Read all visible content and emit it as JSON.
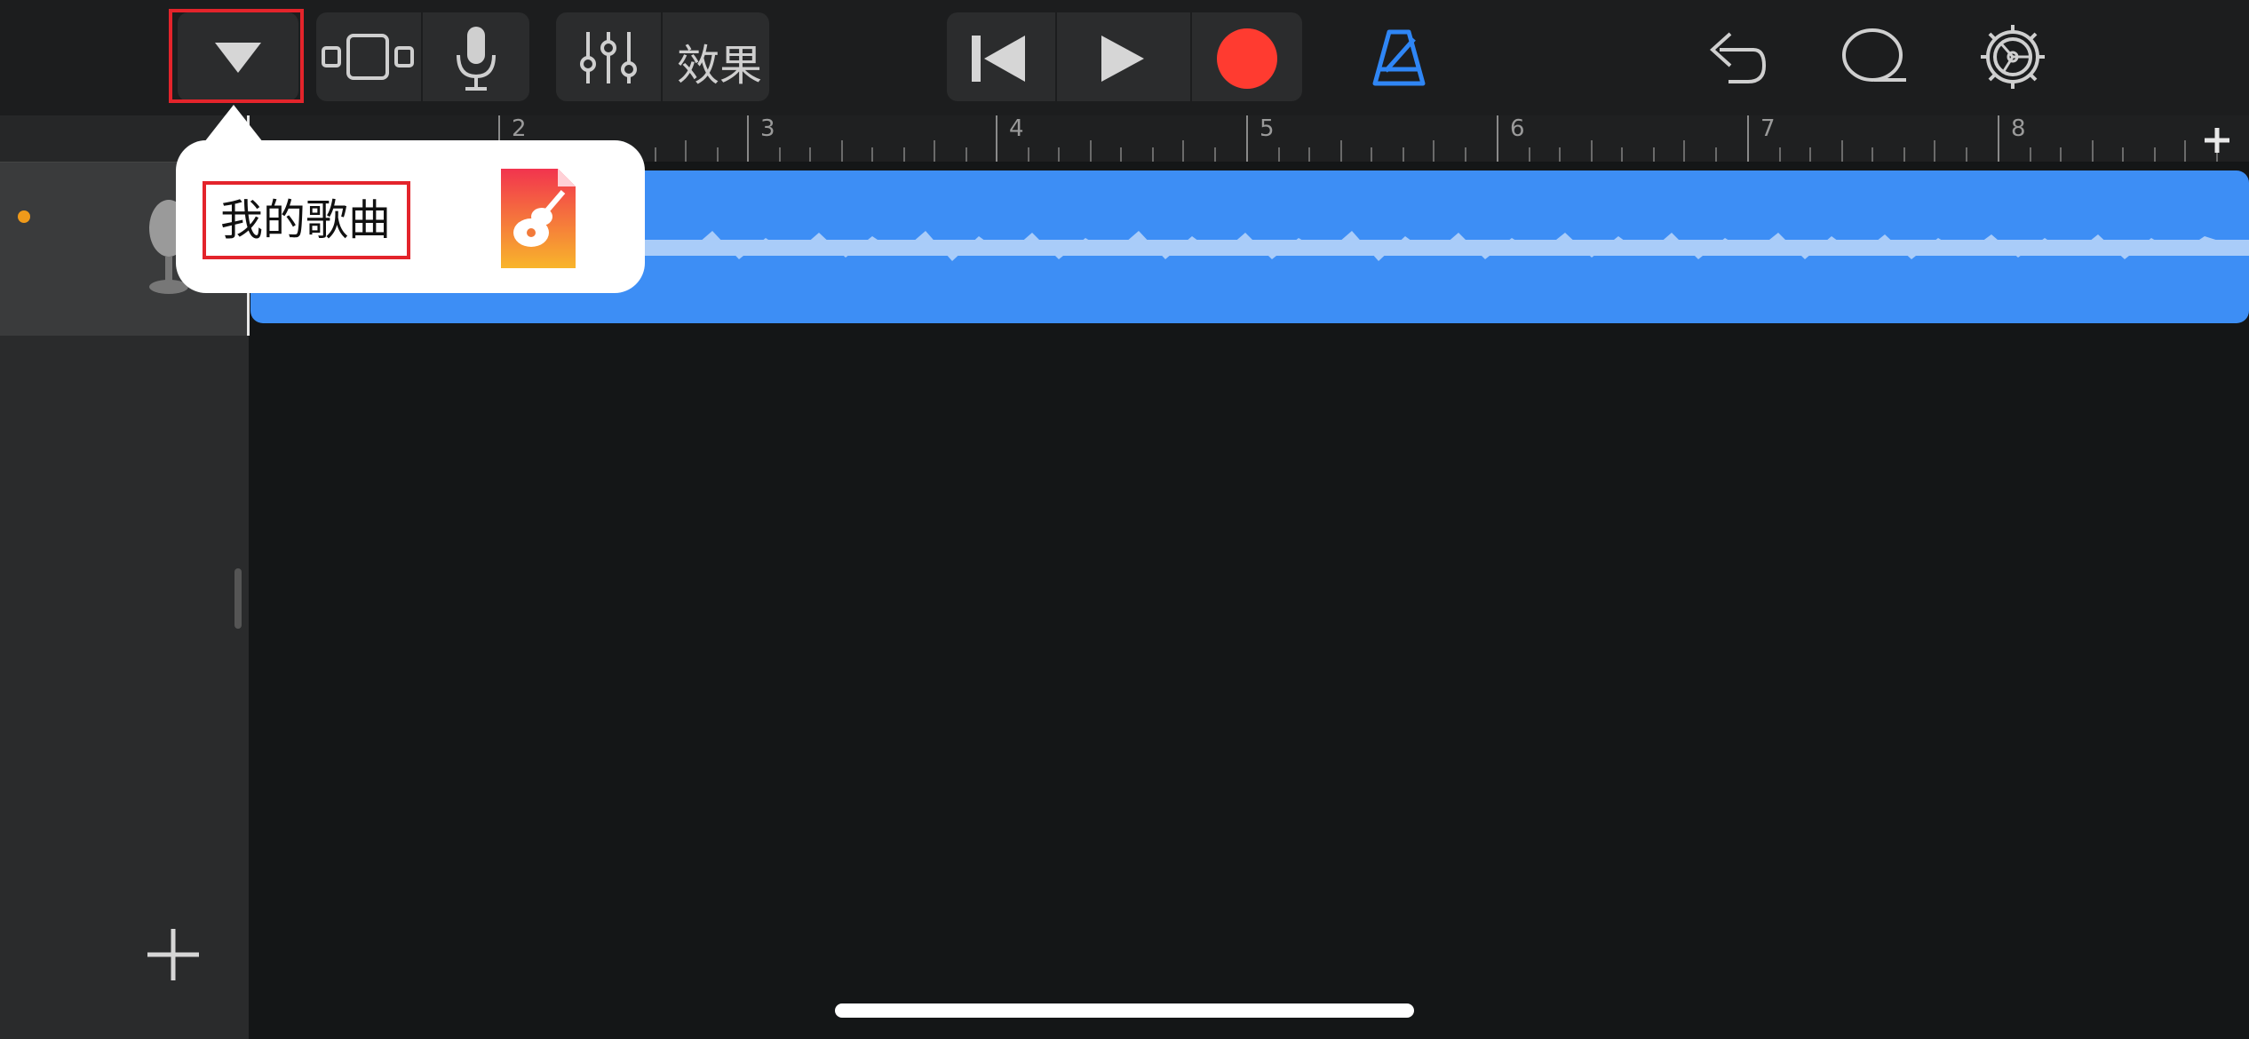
{
  "toolbar": {
    "effects_label": "效果"
  },
  "ruler": {
    "bars": [
      "2",
      "3",
      "4",
      "5",
      "6",
      "7",
      "8"
    ]
  },
  "popover": {
    "song_name": "我的歌曲",
    "app_icon": "garageband-icon"
  },
  "colors": {
    "record": "#ff3b30",
    "accent": "#2f86f5",
    "region": "#3d8ef5",
    "highlight": "#e3242b"
  }
}
